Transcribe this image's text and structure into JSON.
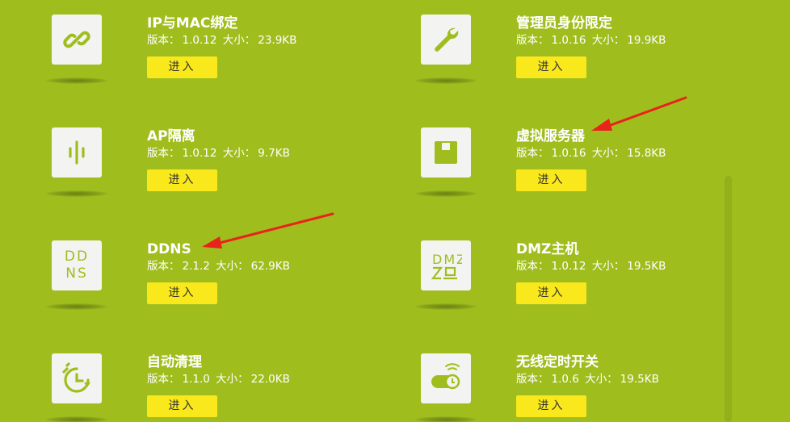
{
  "apps": [
    {
      "title": "IP与MAC绑定",
      "version_label": "版本：",
      "version": "1.0.12",
      "size_label": "大小：",
      "size": "23.9KB",
      "button": "进入",
      "icon": "link-icon"
    },
    {
      "title": "管理员身份限定",
      "version_label": "版本：",
      "version": "1.0.16",
      "size_label": "大小：",
      "size": "19.9KB",
      "button": "进入",
      "icon": "wrench-icon"
    },
    {
      "title": "AP隔离",
      "version_label": "版本：",
      "version": "1.0.12",
      "size_label": "大小：",
      "size": "9.7KB",
      "button": "进入",
      "icon": "ap-isolation-icon"
    },
    {
      "title": "虚拟服务器",
      "version_label": "版本：",
      "version": "1.0.16",
      "size_label": "大小：",
      "size": "15.8KB",
      "button": "进入",
      "icon": "floppy-icon"
    },
    {
      "title": "DDNS",
      "version_label": "版本：",
      "version": "2.1.2",
      "size_label": "大小：",
      "size": "62.9KB",
      "button": "进入",
      "icon": "ddns-icon",
      "icon_text": [
        "DD",
        "NS"
      ]
    },
    {
      "title": "DMZ主机",
      "version_label": "版本：",
      "version": "1.0.12",
      "size_label": "大小：",
      "size": "19.5KB",
      "button": "进入",
      "icon": "dmz-icon",
      "icon_text": [
        "DMZ"
      ]
    },
    {
      "title": "自动清理",
      "version_label": "版本：",
      "version": "1.1.0",
      "size_label": "大小：",
      "size": "22.0KB",
      "button": "进入",
      "icon": "auto-clean-clock-icon"
    },
    {
      "title": "无线定时开关",
      "version_label": "版本：",
      "version": "1.0.6",
      "size_label": "大小：",
      "size": "19.5KB",
      "button": "进入",
      "icon": "wireless-timer-toggle-icon"
    }
  ],
  "colors": {
    "background": "#9fbe1e",
    "button": "#f8e81c",
    "icon_bg": "#f3f3f2",
    "icon_fg": "#9fbe1e",
    "arrow": "#e8231b"
  }
}
